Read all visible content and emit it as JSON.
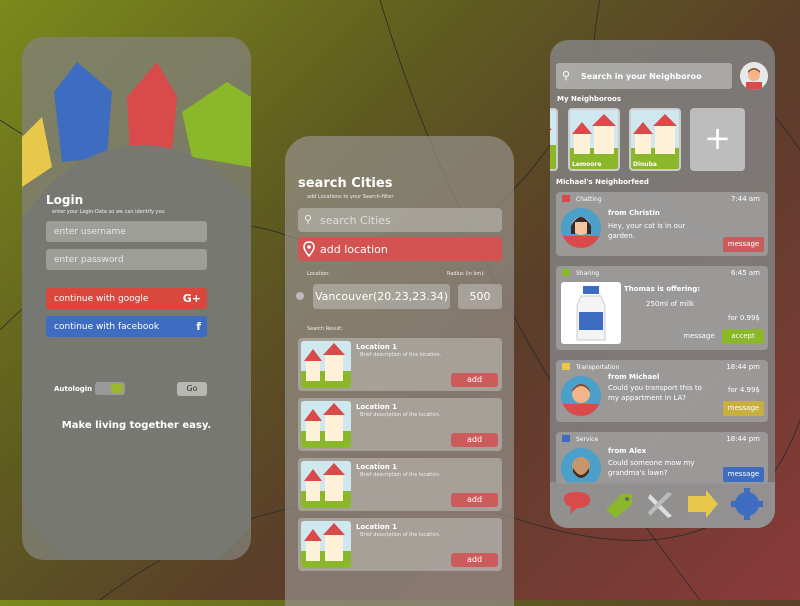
{
  "login": {
    "title": "Login",
    "subtitle": "enter your Login-Data so we can identify you",
    "username_placeholder": "enter username",
    "password_placeholder": "enter password",
    "google_label": "continue with google",
    "google_icon": "G+",
    "facebook_label": "continue with facebook",
    "facebook_icon": "f",
    "autologin_label": "Autologin",
    "go_label": "Go",
    "tagline": "Make living together easy."
  },
  "search": {
    "title": "search Cities",
    "subtitle": "add Locations to your Search-filter",
    "search_placeholder": "search Cities",
    "add_location_label": "add location",
    "location_label": "Location:",
    "radius_label": "Radius (in km):",
    "location_value": "Vancouver(20.23,23.34)",
    "radius_value": "500",
    "results_label": "Search Result:",
    "results": [
      {
        "name": "Location 1",
        "desc": "Brief description of this location.",
        "add": "add"
      },
      {
        "name": "Location 1",
        "desc": "Brief description of the location.",
        "add": "add"
      },
      {
        "name": "Location 1",
        "desc": "Brief description of the location.",
        "add": "add"
      },
      {
        "name": "Location 1",
        "desc": "Brief description of the location.",
        "add": "add"
      }
    ]
  },
  "feed": {
    "search_placeholder": "Search in your Neighboroo",
    "my_neighboroos": "My Neighboroos",
    "neighboroos": [
      "Lemoore",
      "Dinuba"
    ],
    "add_icon": "+",
    "feed_title": "Michael's Neighborfeed",
    "posts": [
      {
        "category": "Chatting",
        "time": "7:44 am",
        "from": "from Christin",
        "message": "Hey, your cat is in our garden.",
        "button": "message"
      },
      {
        "category": "Sharing",
        "time": "6:45 am",
        "from": "Thomas is offering:",
        "message": "250ml of milk",
        "price": "for 0.99$",
        "button": "message",
        "button2": "accept"
      },
      {
        "category": "Transportation",
        "time": "18:44 pm",
        "from": "from Michael",
        "message": "Could you transport this to my appartment in LA?",
        "price": "for 4.99$",
        "button": "message"
      },
      {
        "category": "Service",
        "time": "18:44 pm",
        "from": "from Alex",
        "message": "Could someone mow my grandma's lawn?",
        "button": "message"
      }
    ],
    "colors": {
      "chatting": "#d94a4a",
      "sharing": "#8ab82a",
      "transport": "#e8c84a",
      "service": "#3d6cc1"
    }
  }
}
